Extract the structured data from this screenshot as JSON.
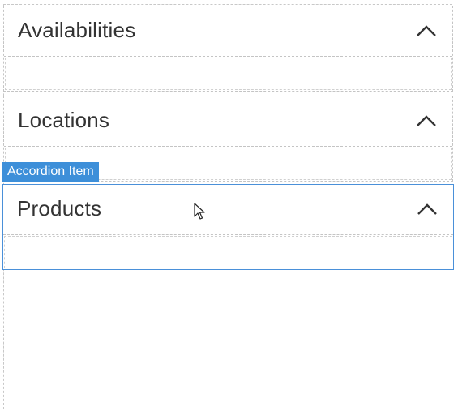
{
  "accordion": {
    "items": [
      {
        "title": "Availabilities",
        "expanded": true
      },
      {
        "title": "Locations",
        "expanded": true
      },
      {
        "title": "Products",
        "expanded": true,
        "selected": true
      }
    ]
  },
  "selection_tag": {
    "label": "Accordion Item",
    "color": "#3d8fd9"
  },
  "icons": {
    "collapse": "chevron-up-icon",
    "pointer": "mouse-pointer-icon"
  }
}
